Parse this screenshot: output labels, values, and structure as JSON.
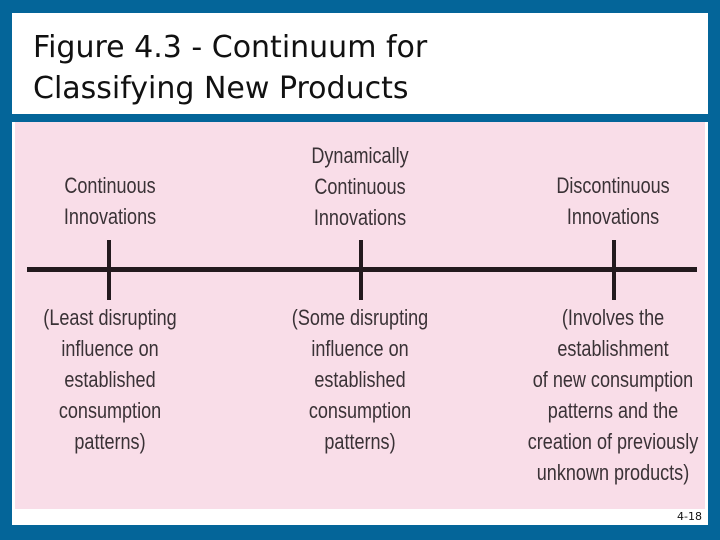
{
  "slide": {
    "title": "Figure 4.3 - Continuum for\nClassifying New Products",
    "slide_number": "4-18",
    "colors": {
      "frame": "#046599",
      "panel": "#f9dde8",
      "axis": "#231a1e",
      "text": "#3a3236"
    }
  },
  "continuum": {
    "categories": [
      {
        "name": "Continuous\nInnovations",
        "description": "(Least disrupting\ninfluence on\nestablished\nconsumption\npatterns)"
      },
      {
        "name": "Dynamically\nContinuous\nInnovations",
        "description": "(Some disrupting\ninfluence on\nestablished\nconsumption\npatterns)"
      },
      {
        "name": "Discontinuous\nInnovations",
        "description": "(Involves the\nestablishment\nof new consumption\npatterns and the\ncreation of previously\nunknown products)"
      }
    ]
  }
}
